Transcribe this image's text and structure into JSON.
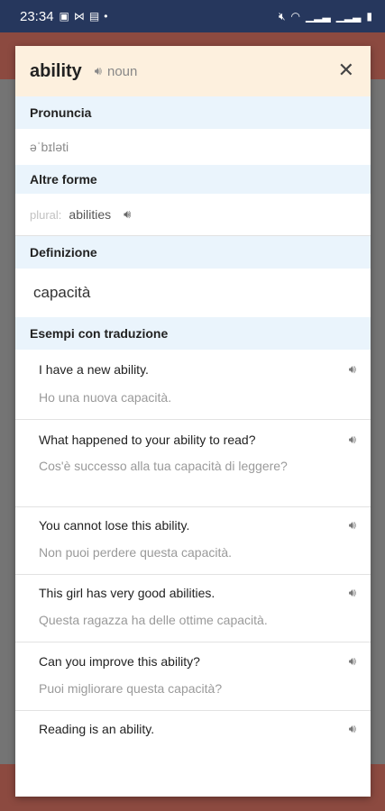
{
  "status_bar": {
    "time": "23:34",
    "left_icons": [
      "image-icon",
      "mail-icon",
      "document-icon",
      "dot-icon"
    ],
    "right_icons": [
      "mute-icon",
      "wifi-icon",
      "signal-icon",
      "signal-icon",
      "battery-icon"
    ]
  },
  "card": {
    "word": "ability",
    "part_of_speech": "noun",
    "pronunciation_header": "Pronuncia",
    "pronunciation": "əˈbɪləti",
    "forms_header": "Altre forme",
    "plural_label": "plural:",
    "plural_value": "abilities",
    "definition_header": "Definizione",
    "definition": "capacità",
    "examples_header": "Esempi con traduzione",
    "examples": [
      {
        "en": "I have a new ability.",
        "it": "Ho una nuova capacità."
      },
      {
        "en": "What happened to your ability to read?",
        "it": "Cos'è successo alla tua capacità di leggere?"
      },
      {
        "en": "You cannot lose this ability.",
        "it": "Non puoi perdere questa capacità."
      },
      {
        "en": "This girl has very good abilities.",
        "it": "Questa ragazza ha delle ottime capacità."
      },
      {
        "en": "Can you improve this ability?",
        "it": "Puoi migliorare questa capacità?"
      },
      {
        "en": "Reading is an ability.",
        "it": ""
      }
    ]
  },
  "bottom_bar": {
    "icons": [
      "graduation-cap-icon",
      "translate-icon",
      "reading-icon",
      "add-icon"
    ]
  },
  "colors": {
    "status_bar": "#26375d",
    "header_bg": "#fdf0de",
    "section_bg": "#eaf4fc",
    "background_accent": "#8c4a40"
  }
}
